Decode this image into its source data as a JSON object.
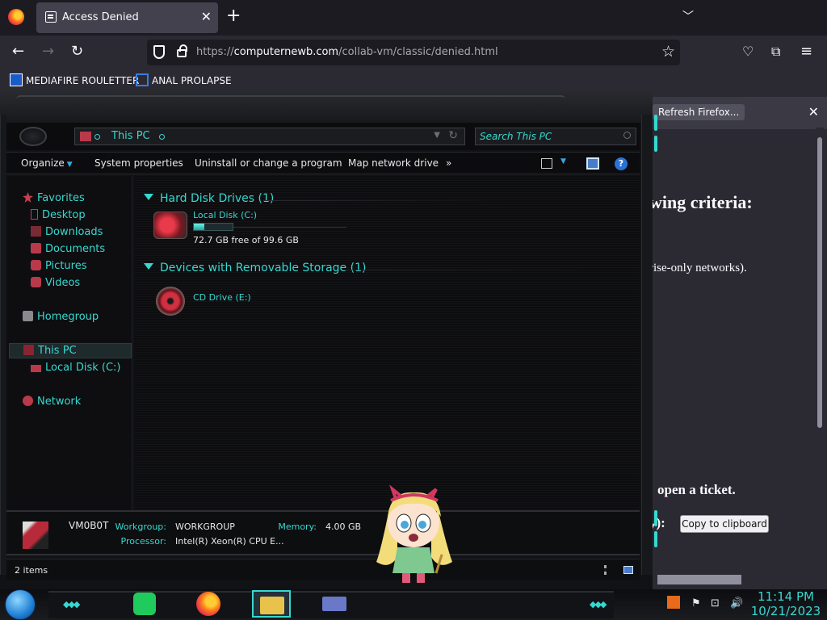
{
  "browser": {
    "tab_title": "Access Denied",
    "url_prefix": "https://",
    "url_domain": "computernewb.com",
    "url_path": "/collab-vm/classic/denied.html",
    "new_tab_symbol": "+",
    "bookmarks": [
      {
        "label": "MEDIAFIRE ROULETTER",
        "icon": "mediafire-icon"
      },
      {
        "label": "ANAL PROLAPSE",
        "icon": "sigma-icon"
      }
    ],
    "notification_button": "Refresh Firefox..."
  },
  "background_page": {
    "heading_fragment": "wing criteria:",
    "line_fragment": "rise-only networks).",
    "ticket_fragment": "open a ticket.",
    "copy_prefix": "y):",
    "copy_button": "Copy to clipboard"
  },
  "explorer": {
    "location": "This PC",
    "search_placeholder": "Search This PC",
    "commands": [
      "Organize",
      "System properties",
      "Uninstall or change a program",
      "Map network drive",
      "»"
    ],
    "nav": {
      "favorites": "Favorites",
      "desktop": "Desktop",
      "downloads": "Downloads",
      "documents": "Documents",
      "pictures": "Pictures",
      "videos": "Videos",
      "homegroup": "Homegroup",
      "this_pc": "This PC",
      "local_disk": "Local Disk (C:)",
      "network": "Network"
    },
    "groups": {
      "hdd": "Hard Disk Drives (1)",
      "removable": "Devices with Removable Storage (1)"
    },
    "drive_c": {
      "name": "Local Disk (C:)",
      "free_text": "72.7 GB free of 99.6 GB",
      "used_fraction": 0.27
    },
    "drive_e": {
      "name": "CD Drive (E:)"
    },
    "details": {
      "pc_name": "VM0B0T",
      "workgroup_label": "Workgroup:",
      "workgroup_value": "WORKGROUP",
      "memory_label": "Memory:",
      "memory_value": "4.00 GB",
      "processor_label": "Processor:",
      "processor_value": "Intel(R) Xeon(R) CPU E..."
    },
    "status_count": "2 items"
  },
  "taskbar": {
    "time": "11:14 PM",
    "date": "10/21/2023"
  },
  "colors": {
    "accent": "#36d8d0",
    "browser_bg": "#1c1b22",
    "explorer_bg": "#111215"
  }
}
